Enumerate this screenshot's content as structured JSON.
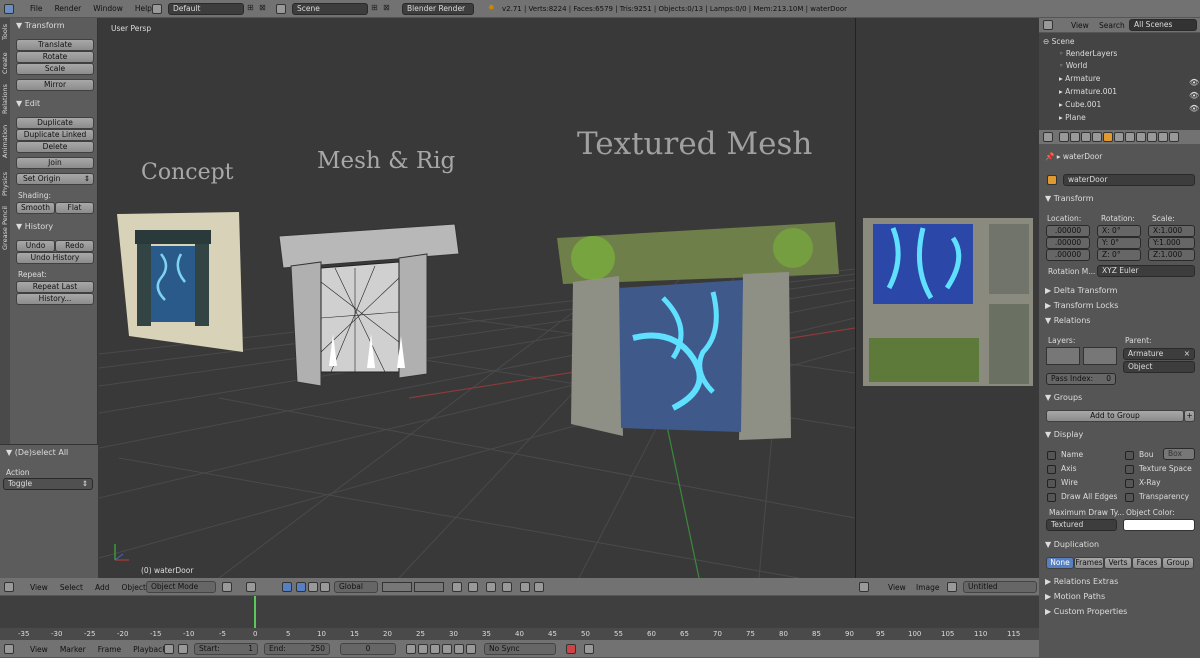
{
  "topbar": {
    "menus": [
      "File",
      "Render",
      "Window",
      "Help"
    ],
    "layout": "Default",
    "scene": "Scene",
    "engine": "Blender Render",
    "stats": "v2.71 | Verts:8224 | Faces:6579 | Tris:9251 | Objects:0/13 | Lamps:0/0 | Mem:213.10M | waterDoor"
  },
  "left_tabs": [
    "Tools",
    "Create",
    "Relations",
    "Animation",
    "Physics",
    "Grease Pencil"
  ],
  "toolshelf": {
    "transform_header": "Transform",
    "translate": "Translate",
    "rotate": "Rotate",
    "scale": "Scale",
    "mirror": "Mirror",
    "edit_header": "Edit",
    "duplicate": "Duplicate",
    "duplicate_linked": "Duplicate Linked",
    "delete": "Delete",
    "join": "Join",
    "set_origin": "Set Origin",
    "shading_label": "Shading:",
    "smooth": "Smooth",
    "flat": "Flat",
    "history_header": "History",
    "undo": "Undo",
    "redo": "Redo",
    "undo_history": "Undo History",
    "repeat_label": "Repeat:",
    "repeat_last": "Repeat Last",
    "history_btn": "History...",
    "operator_header": "(De)select All",
    "action_label": "Action",
    "action_value": "Toggle"
  },
  "viewport": {
    "view_label": "User Persp",
    "object_label": "(0) waterDoor",
    "captions": {
      "concept": "Concept",
      "mesh_rig": "Mesh & Rig",
      "textured": "Textured Mesh"
    }
  },
  "view3d_header": {
    "view": "View",
    "select": "Select",
    "add": "Add",
    "object": "Object",
    "mode": "Object Mode",
    "orientation": "Global"
  },
  "image_editor_header": {
    "view": "View",
    "image": "Image",
    "name": "Untitled"
  },
  "timeline": {
    "ticks": [
      "-35",
      "-30",
      "-25",
      "-20",
      "-15",
      "-10",
      "-5",
      "0",
      "5",
      "10",
      "15",
      "20",
      "25",
      "30",
      "35",
      "40",
      "45",
      "50",
      "55",
      "60",
      "65",
      "70",
      "75",
      "80",
      "85",
      "90",
      "95",
      "100",
      "105",
      "110",
      "115"
    ],
    "current_frame": "0",
    "menus": [
      "View",
      "Marker",
      "Frame",
      "Playback"
    ],
    "start": "Start:",
    "start_value": "1",
    "end": "End:",
    "end_value": "250",
    "frame": "0",
    "sync": "No Sync"
  },
  "outliner": {
    "tabs": [
      "View",
      "Search",
      "All Scenes"
    ],
    "items": [
      "Scene",
      "RenderLayers",
      "World",
      "Armature",
      "Armature.001",
      "Cube.001",
      "Plane"
    ]
  },
  "properties": {
    "path": "waterDoor",
    "object_name": "waterDoor",
    "transform_header": "Transform",
    "location_label": "Location:",
    "rotation_label": "Rotation:",
    "scale_label": "Scale:",
    "loc": [
      ".00000",
      ".00000",
      ".00000"
    ],
    "rot": [
      "X:   0°",
      "Y:   0°",
      "Z:   0°"
    ],
    "scl": [
      "X:1.000",
      "Y:1.000",
      "Z:1.000"
    ],
    "rotation_mode_label": "Rotation M...",
    "rotation_mode": "XYZ Euler",
    "delta_transform": "Delta Transform",
    "transform_locks": "Transform Locks",
    "relations": "Relations",
    "layers_label": "Layers:",
    "parent_label": "Parent:",
    "parent_value": "Armature",
    "parent_type": "Object",
    "pass_index": "Pass Index:",
    "pass_index_value": "0",
    "groups": "Groups",
    "add_to_group": "Add to Group",
    "display": "Display",
    "name": "Name",
    "bou": "Bou",
    "box": "Box",
    "axis": "Axis",
    "texture_space": "Texture Space",
    "wire": "Wire",
    "xray": "X-Ray",
    "draw_all_edges": "Draw All Edges",
    "transparency": "Transparency",
    "max_draw_label": "Maximum Draw Ty...",
    "object_color_label": "Object Color:",
    "max_draw_value": "Textured",
    "duplication": "Duplication",
    "dup_tabs": [
      "None",
      "Frames",
      "Verts",
      "Faces",
      "Group"
    ],
    "relations_extras": "Relations Extras",
    "motion_paths": "Motion Paths",
    "custom_properties": "Custom Properties"
  }
}
